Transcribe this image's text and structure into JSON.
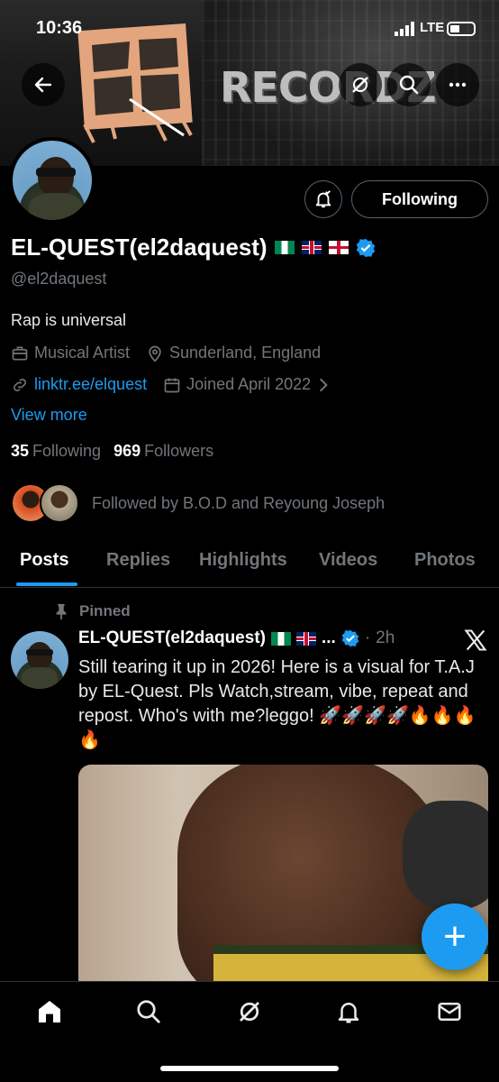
{
  "status_bar": {
    "time": "10:36",
    "network": "LTE"
  },
  "banner": {
    "logo_text": "RECORDZ"
  },
  "profile": {
    "display_name": "EL-QUEST(el2daquest)",
    "handle": "@el2daquest",
    "bio": "Rap is universal",
    "category": "Musical Artist",
    "location": "Sunderland, England",
    "website": "linktr.ee/elquest",
    "joined": "Joined April 2022",
    "view_more": "View more",
    "following_count": "35",
    "following_label": "Following",
    "followers_count": "969",
    "followers_label": "Followers",
    "followed_by": "Followed by B.O.D and Reyoung Joseph",
    "follow_button_label": "Following"
  },
  "tabs": [
    {
      "label": "Posts"
    },
    {
      "label": "Replies"
    },
    {
      "label": "Highlights"
    },
    {
      "label": "Videos"
    },
    {
      "label": "Photos"
    }
  ],
  "post": {
    "pinned_label": "Pinned",
    "author_name": "EL-QUEST(el2daquest)",
    "ellipsis": "...",
    "separator": "·",
    "time": "2h",
    "text": "Still tearing it up in 2026!  Here is a visual for T.A.J by EL-Quest. Pls  Watch,stream, vibe, repeat and repost. Who's with me?leggo! 🚀🚀🚀🚀🔥🔥🔥🔥"
  },
  "fab_label": "+",
  "colors": {
    "accent": "#1d9bf0",
    "background": "#000000",
    "muted": "#71767b"
  },
  "icons": [
    "back-arrow-icon",
    "grok-icon",
    "search-icon",
    "more-icon",
    "notification-bell-icon",
    "verified-badge-icon",
    "briefcase-icon",
    "location-pin-icon",
    "link-icon",
    "calendar-icon",
    "pin-icon",
    "x-logo-icon",
    "home-icon",
    "explore-icon",
    "grok-nav-icon",
    "notifications-icon",
    "messages-icon"
  ]
}
